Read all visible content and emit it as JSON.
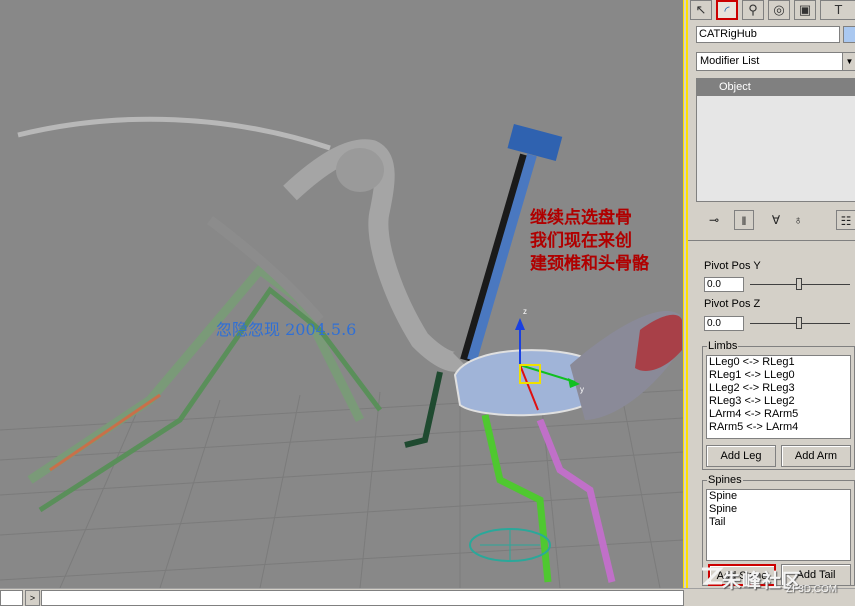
{
  "annotation": {
    "line1": "继续点选盘骨",
    "line2": "我们现在来创",
    "line3": "建颈椎和头骨骼"
  },
  "watermark": "忽隐忽现 2004.5.6",
  "viewport": {
    "gizmo_axis_x": "x",
    "gizmo_axis_y": "y",
    "gizmo_axis_z": "z"
  },
  "panel": {
    "tabs": [
      {
        "icon": "pointer-icon"
      },
      {
        "icon": "modify-arc-icon"
      },
      {
        "icon": "hierarchy-icon"
      },
      {
        "icon": "motion-icon"
      },
      {
        "icon": "display-icon"
      },
      {
        "icon": "utilities-hammer-icon"
      }
    ],
    "object_name": "CATRigHub",
    "modifier_list": "Modifier List",
    "stack_item": "Object",
    "pivot_y_label": "Pivot Pos Y",
    "pivot_y_value": "0.0",
    "pivot_z_label": "Pivot Pos Z",
    "pivot_z_value": "0.0",
    "limbs": {
      "title": "Limbs",
      "items": [
        "LLeg0 <-> RLeg1",
        "RLeg1 <-> LLeg0",
        "LLeg2 <-> RLeg3",
        "RLeg3 <-> LLeg2",
        "LArm4 <-> RArm5",
        "RArm5 <-> LArm4"
      ],
      "add_leg": "Add Leg",
      "add_arm": "Add Arm"
    },
    "spines": {
      "title": "Spines",
      "items": [
        "Spine",
        "Spine",
        "Tail"
      ],
      "add_spine": "Add Spine",
      "add_tail": "Add Tail"
    }
  },
  "site": {
    "name": "朱峰社区",
    "url": "ZF3D.COM"
  }
}
